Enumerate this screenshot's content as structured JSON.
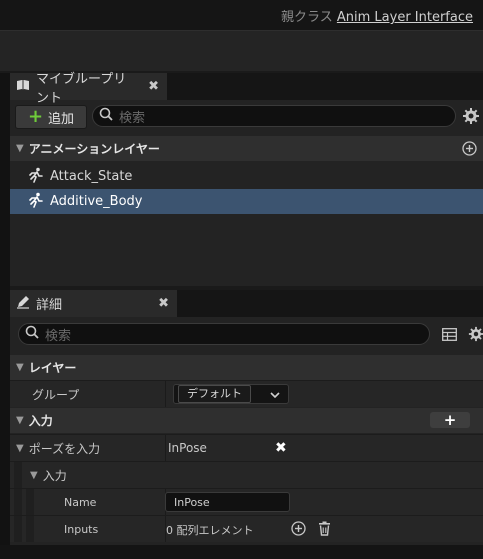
{
  "header": {
    "parent_class_label": "親クラス",
    "parent_class_value": "Anim Layer Interface"
  },
  "my_blueprint": {
    "tab_label": "マイブループリント",
    "add_label": "追加",
    "search_placeholder": "検索",
    "section_title": "アニメーションレイヤー",
    "layers": [
      {
        "label": "Attack_State",
        "selected": false
      },
      {
        "label": "Additive_Body",
        "selected": true
      }
    ]
  },
  "details": {
    "tab_label": "詳細",
    "search_placeholder": "検索",
    "layer_section": "レイヤー",
    "group_label": "グループ",
    "group_value": "デフォルト",
    "inputs_section": "入力",
    "pose_input_label": "ポーズを入力",
    "pose_input_value": "InPose",
    "sub_inputs_label": "入力",
    "name_label": "Name",
    "name_value": "InPose",
    "inputs_label": "Inputs",
    "inputs_value": "0 配列エレメント"
  },
  "colors": {
    "accent_blue": "#2d6dd6",
    "selection": "#3c5470",
    "add_green": "#6fcb3a"
  }
}
